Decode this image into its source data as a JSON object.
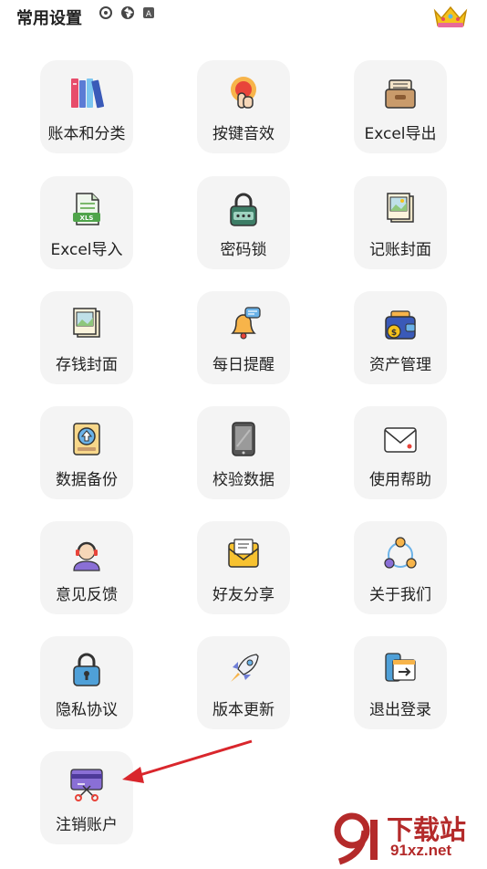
{
  "header": {
    "title": "常用设置"
  },
  "tiles": [
    {
      "label": "账本和分类",
      "icon": "books-icon"
    },
    {
      "label": "按键音效",
      "icon": "press-button-icon"
    },
    {
      "label": "Excel导出",
      "icon": "drawer-icon"
    },
    {
      "label": "Excel导入",
      "icon": "xls-file-icon"
    },
    {
      "label": "密码锁",
      "icon": "password-lock-icon"
    },
    {
      "label": "记账封面",
      "icon": "picture-frame-icon"
    },
    {
      "label": "存钱封面",
      "icon": "photo-icon"
    },
    {
      "label": "每日提醒",
      "icon": "bell-icon"
    },
    {
      "label": "资产管理",
      "icon": "wallet-icon"
    },
    {
      "label": "数据备份",
      "icon": "backup-disk-icon"
    },
    {
      "label": "校验数据",
      "icon": "tablet-icon"
    },
    {
      "label": "使用帮助",
      "icon": "envelope-icon"
    },
    {
      "label": "意见反馈",
      "icon": "headset-agent-icon"
    },
    {
      "label": "好友分享",
      "icon": "share-mail-icon"
    },
    {
      "label": "关于我们",
      "icon": "network-circle-icon"
    },
    {
      "label": "隐私协议",
      "icon": "padlock-icon"
    },
    {
      "label": "版本更新",
      "icon": "rocket-icon"
    },
    {
      "label": "退出登录",
      "icon": "logout-screen-icon"
    },
    {
      "label": "注销账户",
      "icon": "cut-card-icon"
    }
  ],
  "watermark": {
    "top": "下载站",
    "bottom": "91xz.net"
  },
  "colors": {
    "tile_bg": "#f4f4f4",
    "arrow": "#d9262c",
    "watermark": "#b42a2a"
  }
}
